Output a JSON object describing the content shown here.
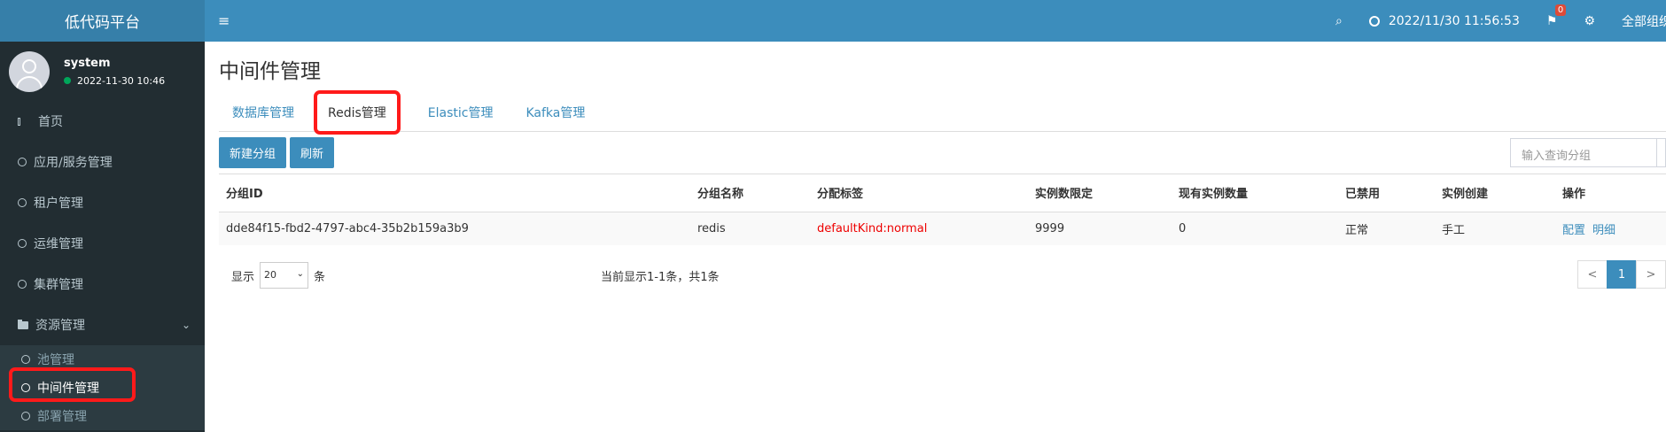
{
  "sidebar": {
    "logo": "低代码平台",
    "user_name": "system",
    "user_status": "2022-11-30 10:46",
    "items": [
      {
        "label": "首页"
      },
      {
        "label": "应用/服务管理"
      },
      {
        "label": "租户管理"
      },
      {
        "label": "运维管理"
      },
      {
        "label": "集群管理"
      },
      {
        "label": "资源管理"
      }
    ],
    "subitems": [
      {
        "label": "池管理"
      },
      {
        "label": "中间件管理"
      },
      {
        "label": "部署管理"
      }
    ]
  },
  "topbar": {
    "menu_icon": "≡",
    "search_icon": "⌕",
    "datetime": "2022/11/30 11:56:53",
    "flag_icon": "⚑",
    "notification_count": "0",
    "cog_icon": "⚙",
    "all_groups": "全部组织"
  },
  "main": {
    "title": "中间件管理",
    "tabs": [
      {
        "label": "数据库管理"
      },
      {
        "label": "Redis管理"
      },
      {
        "label": "Elastic管理"
      },
      {
        "label": "Kafka管理"
      }
    ],
    "buttons": {
      "new_group": "新建分组",
      "refresh": "刷新"
    },
    "search_placeholder": "输入查询分组",
    "table": {
      "headers": [
        "分组ID",
        "分组名称",
        "分配标签",
        "实例数限定",
        "现有实例数量",
        "已禁用",
        "实例创建",
        "操作"
      ],
      "rows": [
        {
          "id": "dde84f15-fbd2-4797-abc4-35b2b159a3b9",
          "name": "redis",
          "label": "defaultKind:normal",
          "limit": "9999",
          "count": "0",
          "disabled": "正常",
          "creation": "手工",
          "op_config": "配置",
          "op_detail": "明细"
        }
      ]
    },
    "footer": {
      "show": "显示",
      "page_size": "20",
      "unit": "条",
      "info": "当前显示1-1条，共1条",
      "prev": "<",
      "page": "1",
      "next": ">"
    }
  },
  "colors": {
    "accent": "#3c8dbc",
    "sidebar": "#222d32",
    "highlight": "#ff1a1a"
  }
}
